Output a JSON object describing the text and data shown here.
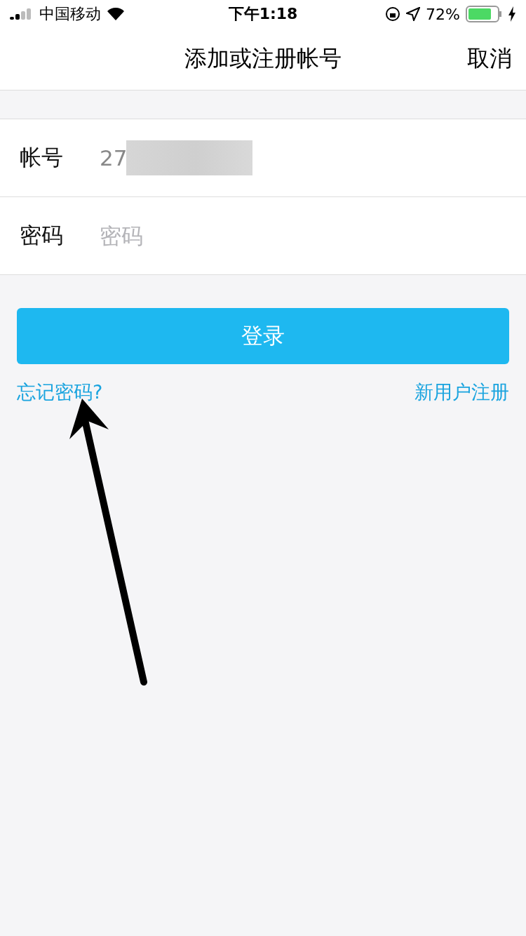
{
  "status_bar": {
    "carrier": "中国移动",
    "time": "下午1:18",
    "battery": "72%"
  },
  "nav": {
    "title": "添加或注册帐号",
    "cancel": "取消"
  },
  "form": {
    "rows": [
      {
        "label": "帐号",
        "value": "27",
        "placeholder": "",
        "masked": true
      },
      {
        "label": "密码",
        "value": "",
        "placeholder": "密码",
        "masked": false
      }
    ]
  },
  "login_button": "登录",
  "links": {
    "forgot": "忘记密码?",
    "register": "新用户注册"
  }
}
